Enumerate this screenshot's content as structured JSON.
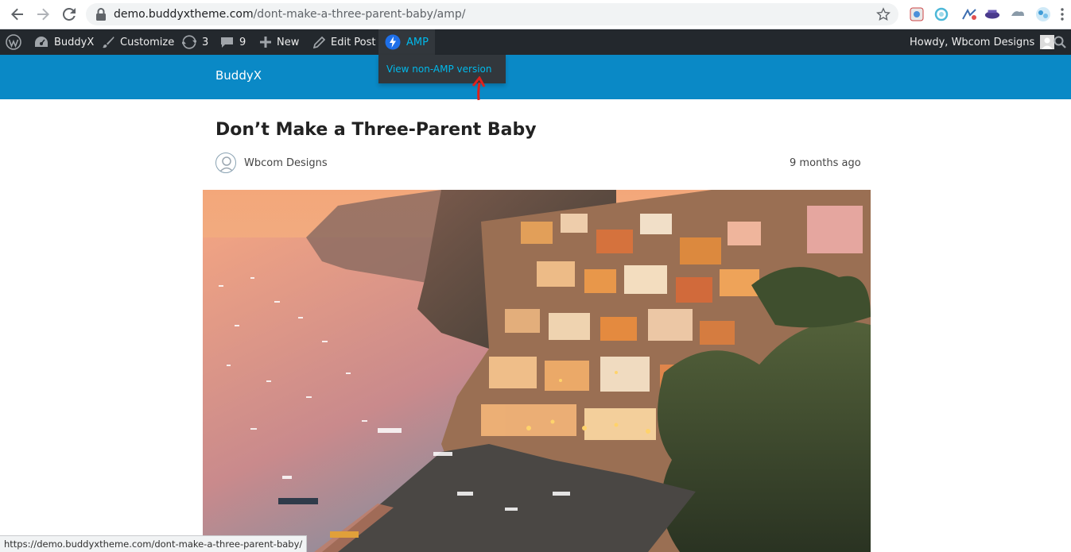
{
  "browser": {
    "url_host": "demo.buddyxtheme.com",
    "url_path": "/dont-make-a-three-parent-baby/amp/",
    "icons": [
      "back-icon",
      "forward-icon",
      "reload-icon",
      "lock-icon",
      "star-icon"
    ],
    "extensions": [
      "extension-icon-1",
      "extension-icon-2",
      "extension-icon-3",
      "extension-icon-4",
      "extension-icon-5",
      "extension-icon-6"
    ]
  },
  "adminbar": {
    "site_name": "BuddyX",
    "customize": "Customize",
    "updates_count": "3",
    "comments_count": "9",
    "new": "New",
    "edit_post": "Edit Post",
    "amp": "AMP",
    "howdy": "Howdy, Wbcom Designs",
    "amp_menu_item": "View non-AMP version"
  },
  "site": {
    "title": "BuddyX",
    "header_color": "#0a89c6"
  },
  "post": {
    "title": "Don’t Make a Three-Parent Baby",
    "author": "Wbcom Designs",
    "time": "9 months ago"
  },
  "status_bar": {
    "url": "https://demo.buddyxtheme.com/dont-make-a-three-parent-baby/"
  },
  "colors": {
    "adminbar_bg": "#23282d",
    "amp_accent": "#00b9eb",
    "annotation_arrow": "#e0201b"
  }
}
